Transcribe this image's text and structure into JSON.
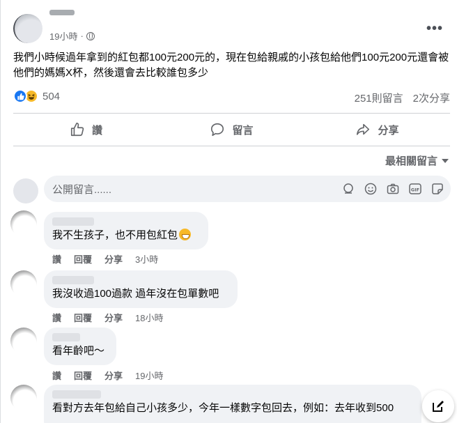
{
  "post": {
    "time": "19小時",
    "dot": "·",
    "text": "我們小時候過年拿到的紅包都100元200元的，現在包給親戚的小孩包給他們100元200元還會被他們的媽媽X杯，然後還會去比較誰包多少",
    "reaction_count": "504",
    "comments_count": "251則留言",
    "shares_count": "2次分享",
    "more_label": "•••"
  },
  "actions": {
    "like": "讚",
    "comment": "留言",
    "share": "分享"
  },
  "sort_label": "最相關留言",
  "comment_box": {
    "placeholder": "公開留言......"
  },
  "comments": [
    {
      "text": "我不生孩子，也不用包紅包",
      "like": "讚",
      "reply": "回覆",
      "share": "分享",
      "time": "3小時"
    },
    {
      "text": "我沒收過100過款 過年沒在包單數吧",
      "like": "讚",
      "reply": "回覆",
      "share": "分享",
      "time": "18小時"
    },
    {
      "text": "看年齡吧～",
      "like": "讚",
      "reply": "回覆",
      "share": "分享",
      "time": "19小時"
    },
    {
      "text": "看對方去年包給自己小孩多少，今年一樣數字包回去，例如：去年收到500"
    }
  ],
  "icons": {
    "like": "thumbs-up-icon",
    "comment": "speech-bubble-icon",
    "share": "share-arrow-icon",
    "sticker": "sticker-icon",
    "emoji": "smiley-icon",
    "camera": "camera-icon",
    "gif": "gif-icon",
    "avatar_sticker": "avatar-sticker-icon",
    "compose": "compose-icon",
    "globe": "globe-icon"
  },
  "colors": {
    "like_blue": "#1877f2",
    "haha_yellow": "#f7b928",
    "secondary_text": "#65676b",
    "bubble_bg": "#f0f2f5"
  }
}
